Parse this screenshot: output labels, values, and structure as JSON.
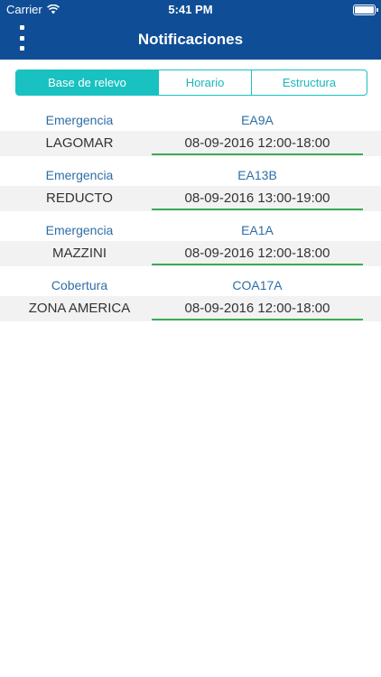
{
  "status": {
    "carrier": "Carrier",
    "time": "5:41 PM"
  },
  "nav": {
    "title": "Notificaciones",
    "menu_icon": "more-vertical-icon"
  },
  "tabs": [
    {
      "label": "Base de relevo",
      "active": true
    },
    {
      "label": "Horario",
      "active": false
    },
    {
      "label": "Estructura",
      "active": false
    }
  ],
  "notifications": [
    {
      "type": "Emergencia",
      "code": "EA9A",
      "base": "LAGOMAR",
      "datetime": "08-09-2016  12:00-18:00"
    },
    {
      "type": "Emergencia",
      "code": "EA13B",
      "base": "REDUCTO",
      "datetime": "08-09-2016  13:00-19:00"
    },
    {
      "type": "Emergencia",
      "code": "EA1A",
      "base": "MAZZINI",
      "datetime": "08-09-2016  12:00-18:00"
    },
    {
      "type": "Cobertura",
      "code": "COA17A",
      "base": "ZONA AMERICA",
      "datetime": "08-09-2016  12:00-18:00"
    }
  ],
  "colors": {
    "nav": "#0f4e96",
    "accent": "#19c1c1",
    "label": "#2d6ea6",
    "underline": "#3cab55"
  }
}
